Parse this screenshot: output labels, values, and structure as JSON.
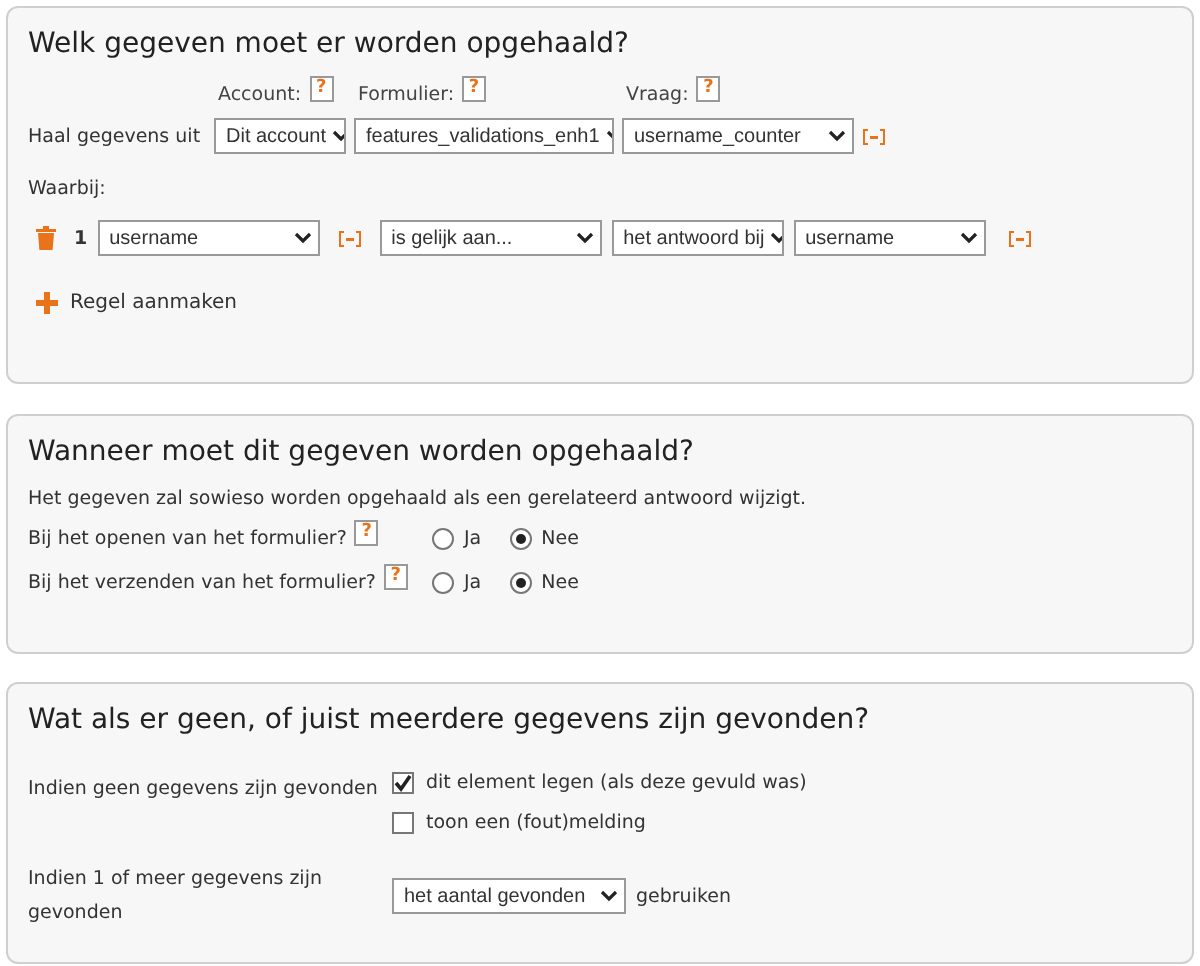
{
  "source_section": {
    "title": "Welk gegeven moet er worden opgehaald?",
    "column_labels": [
      {
        "label": "Account:",
        "help": "?"
      },
      {
        "label": "Formulier:",
        "help": "?"
      },
      {
        "label": "Vraag:",
        "help": "?"
      }
    ],
    "row_label": "Haal gegevens uit",
    "selects": [
      "Dit account",
      "features_validations_enh1",
      "username_counter"
    ],
    "where_label": "Waarbij:",
    "conditions": [
      {
        "number": "1",
        "field": "username",
        "operator": "is gelijk aan...",
        "source": "het antwoord bij",
        "question": "username"
      }
    ],
    "add_label": "Regel aanmaken"
  },
  "timing_section": {
    "title": "Wanneer moet dit gegeven worden opgehaald?",
    "description": "Het gegeven zal sowieso worden opgehaald als een gerelateerd antwoord wijzigt.",
    "questions": [
      {
        "label": "Bij het openen van het formulier?",
        "help": "?",
        "options": [
          {
            "label": "Ja",
            "selected": false
          },
          {
            "label": "Nee",
            "selected": true
          }
        ]
      },
      {
        "label": "Bij het verzenden van het formulier?",
        "help": "?",
        "options": [
          {
            "label": "Ja",
            "selected": false
          },
          {
            "label": "Nee",
            "selected": true
          }
        ]
      }
    ]
  },
  "result_section": {
    "title": "Wat als er geen, of juist meerdere gegevens zijn gevonden?",
    "rows": [
      {
        "kind": "checkboxes",
        "label": "Indien geen gegevens zijn gevonden",
        "checkboxes": [
          {
            "label": "dit element legen (als deze gevuld was)",
            "checked": true
          },
          {
            "label": "toon een (fout)melding",
            "checked": false
          }
        ]
      },
      {
        "kind": "select",
        "label": "Indien 1 of meer gegevens zijn gevonden",
        "select": "het aantal gevonden",
        "suffix": "gebruiken"
      }
    ]
  }
}
